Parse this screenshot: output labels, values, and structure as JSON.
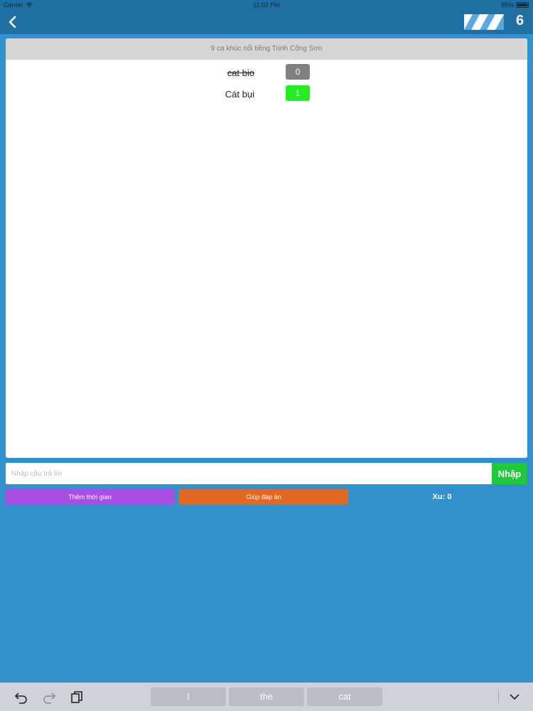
{
  "status_bar": {
    "carrier": "Carrier",
    "time": "11:02 PM",
    "battery": "95%"
  },
  "nav": {
    "level": "6"
  },
  "card": {
    "title": "9 ca khúc nổi tiếng Trịnh Công Sơn",
    "answers": [
      {
        "text": "cat bio",
        "count": "0",
        "status": "wrong"
      },
      {
        "text": "Cát bụi",
        "count": "1",
        "status": "correct"
      }
    ]
  },
  "input": {
    "placeholder": "Nhập câu trả lời",
    "value": "",
    "submit_label": "Nhập"
  },
  "actions": {
    "add_time_label": "Thêm thời gian",
    "help_label": "Giúp đáp án",
    "coins_text": "Xu: 0"
  },
  "keyboard": {
    "suggestions": [
      "I",
      "the",
      "cat"
    ]
  },
  "colors": {
    "background": "#3291cc",
    "nav_bar": "#1f6fa3",
    "submit": "#20c93a",
    "add_time": "#a84ee3",
    "help": "#e06a23",
    "badge_correct": "#22ee22",
    "badge_wrong": "#808080"
  }
}
